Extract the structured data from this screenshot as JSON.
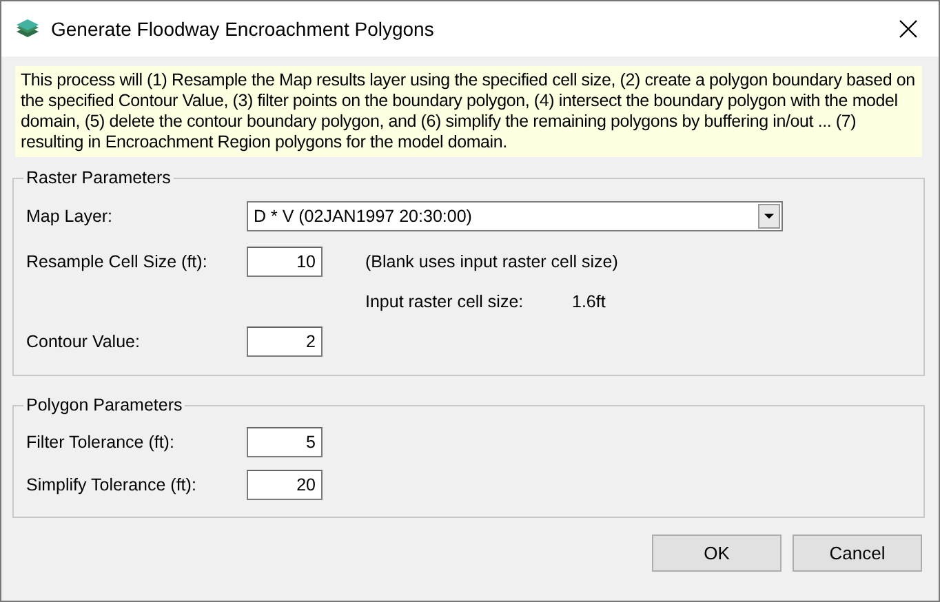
{
  "window": {
    "title": "Generate Floodway Encroachment Polygons"
  },
  "description": "This process will (1) Resample the Map results layer using the specified cell size, (2) create a polygon boundary based on the specified Contour Value, (3) filter points on the boundary polygon, (4) intersect the boundary polygon with the model domain, (5) delete the contour boundary polygon, and (6) simplify the remaining polygons by buffering in/out ... (7) resulting in Encroachment Region polygons for the model domain.",
  "raster_parameters": {
    "title": "Raster Parameters",
    "map_layer": {
      "label": "Map Layer:",
      "value": "D * V (02JAN1997 20:30:00)"
    },
    "resample_cell_size": {
      "label": "Resample Cell Size (ft):",
      "value": "10",
      "note": "(Blank uses input raster cell size)"
    },
    "input_cell_size": {
      "label": "Input raster cell size:",
      "value": "1.6ft"
    },
    "contour_value": {
      "label": "Contour Value:",
      "value": "2"
    }
  },
  "polygon_parameters": {
    "title": "Polygon Parameters",
    "fields": [
      {
        "label": "Filter Tolerance (ft):",
        "value": "5"
      },
      {
        "label": "Simplify Tolerance (ft):",
        "value": "20"
      }
    ]
  },
  "buttons": [
    "OK",
    "Cancel"
  ]
}
